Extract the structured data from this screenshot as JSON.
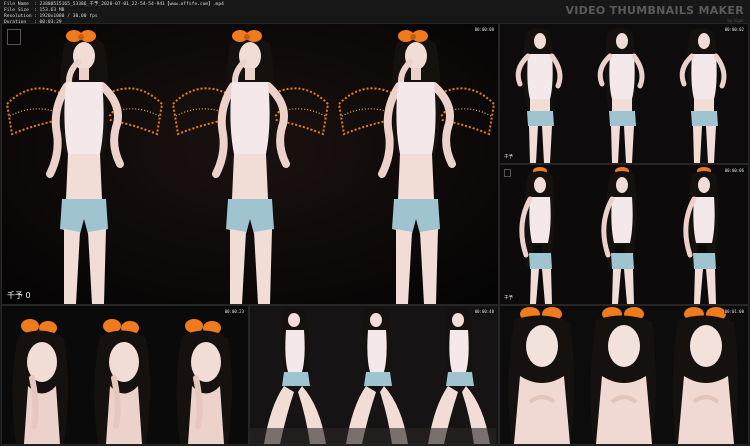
{
  "header": {
    "file_name_label": "File Name",
    "file_name": ": 23880515165_53386_千予_2020-07-01_22-54-54-941【www.offsfe.com】.mp4",
    "file_size_label": "File Size",
    "file_size": ": 153.63 MB",
    "resolution_label": "Resolution",
    "resolution": ": 1920x1080 / 30.00 fps",
    "duration_label": "Duration",
    "duration": ": 00:03:29",
    "brand_title": "VIDEO THUMBNAILS MAKER",
    "brand_sub": "by Vigor"
  },
  "thumbnails": [
    {
      "timestamp": "00:00:08",
      "watermark": "千予  0"
    },
    {
      "timestamp": "00:00:02",
      "watermark": "千予"
    },
    {
      "timestamp": "00:00:06",
      "watermark": "千予"
    },
    {
      "timestamp": "00:00:23",
      "watermark": ""
    },
    {
      "timestamp": "00:00:40",
      "watermark": ""
    },
    {
      "timestamp": "00:01:00",
      "watermark": ""
    }
  ],
  "colors": {
    "background": "#1b1b1b",
    "bow": "#f07a1e",
    "wing_glow": "#ff8a1a",
    "skin": "#f1dcd6",
    "top": "#f4e8ea",
    "shorts": "#9fc3cf",
    "hair": "#15110f"
  },
  "icons": {
    "channel_logo": "logo-icon"
  }
}
